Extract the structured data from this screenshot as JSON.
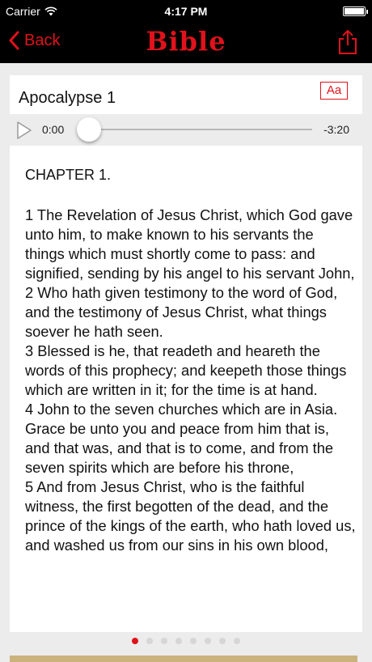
{
  "status": {
    "carrier": "Carrier",
    "time": "4:17 PM"
  },
  "nav": {
    "back_label": "Back",
    "title": "Bible"
  },
  "header": {
    "chapter_title": "Apocalypse 1",
    "font_button_label": "Aa"
  },
  "audio": {
    "elapsed": "0:00",
    "remaining": "-3:20",
    "progress": 0
  },
  "reading": {
    "chapter_heading": "CHAPTER 1.",
    "verses": [
      "1 The Revelation of Jesus Christ, which God gave unto him, to make known to his servants the things which must shortly come to pass: and signified, sending by his angel to his servant John,",
      "2 Who hath given testimony to the word of God, and the testimony of Jesus Christ, what things soever he hath seen.",
      "3 Blessed is he, that readeth and heareth the words of this prophecy; and keepeth those things which are written in it; for the time is at hand.",
      "4 John to the seven churches which are in Asia. Grace be unto you and peace from him that is, and that was, and that is to come, and from the seven spirits which are before his throne,",
      "5 And from Jesus Christ, who is the faithful witness, the first begotten of the dead, and the prince of the kings of the earth, who hath loved us, and washed us from our sins in his own blood,"
    ]
  },
  "pager": {
    "count": 8,
    "active_index": 0
  },
  "colors": {
    "accent": "#e0121b",
    "bar_background": "#000000",
    "page_background": "#ececec"
  },
  "icons": {
    "wifi": "wifi-icon",
    "battery": "battery-icon",
    "back": "chevron-left-icon",
    "share": "share-icon",
    "play": "play-icon"
  }
}
